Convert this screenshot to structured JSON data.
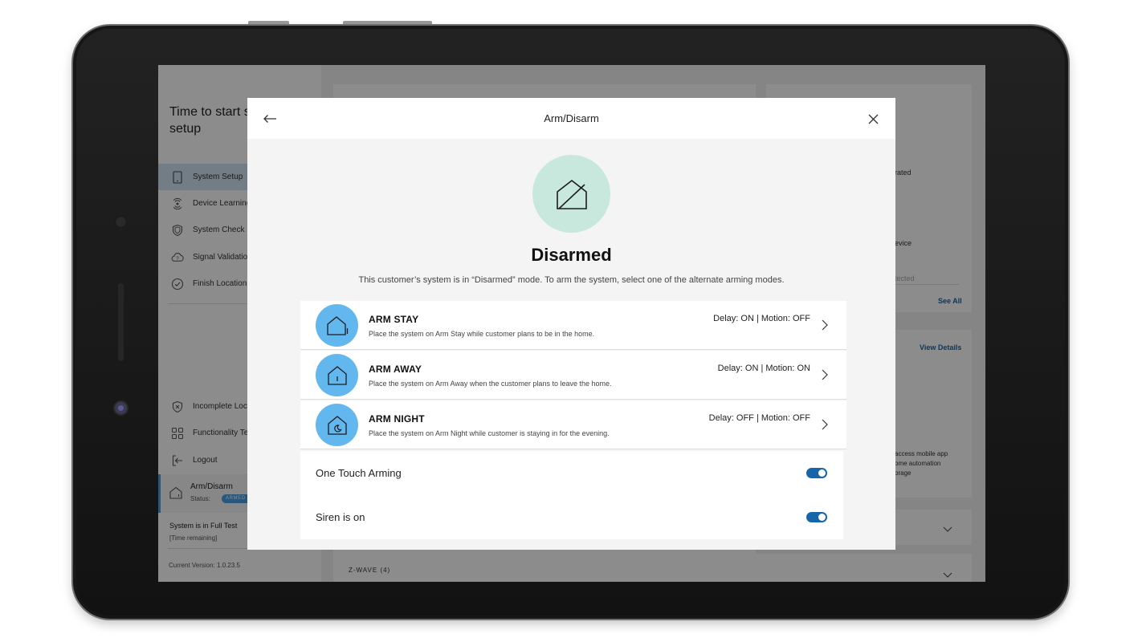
{
  "sidebar": {
    "title": "Time to start system setup",
    "items": [
      {
        "label": "System Setup",
        "icon": "tablet-icon",
        "active": true
      },
      {
        "label": "Device Learning",
        "icon": "signal-icon"
      },
      {
        "label": "System Check",
        "icon": "shield-icon"
      },
      {
        "label": "Signal Validation",
        "icon": "cloud-question-icon"
      },
      {
        "label": "Finish Location",
        "icon": "check-circle-icon"
      }
    ],
    "bottom_items": [
      {
        "label": "Incomplete Location",
        "icon": "shield-x-icon"
      },
      {
        "label": "Functionality Test",
        "icon": "grid-icon"
      },
      {
        "label": "Logout",
        "icon": "logout-icon"
      }
    ],
    "arm_card": {
      "label": "Arm/Disarm",
      "status_label": "Status:",
      "badge": "ARMED AWAY"
    },
    "test_status": "System is in Full Test",
    "time_remaining": "[Time remaining]",
    "version": "Current Version: 1.0.23.5"
  },
  "background": {
    "rated_text": "rated",
    "device_text": "evice",
    "detected_text": "tected",
    "see_all": "See All",
    "view_details": "View Details",
    "app_lines": [
      "access mobile app",
      "ome automation",
      "orage"
    ],
    "zwave": "Z-WAVE (4)"
  },
  "modal": {
    "title": "Arm/Disarm",
    "status": "Disarmed",
    "description": "This customer’s system is in “Disarmed” mode. To arm the system, select one of the alternate arming modes.",
    "modes": [
      {
        "name": "ARM STAY",
        "description": "Place the system on Arm Stay while customer plans to be in the home.",
        "status": "Delay: ON | Motion: OFF"
      },
      {
        "name": "ARM AWAY",
        "description": "Place the system on Arm Away when the customer plans to leave the home.",
        "status": "Delay: ON | Motion: ON"
      },
      {
        "name": "ARM NIGHT",
        "description": "Place the system on Arm Night while customer is staying in for the evening.",
        "status": "Delay: OFF | Motion: OFF"
      }
    ],
    "toggles": [
      {
        "label": "One Touch Arming",
        "on": true
      },
      {
        "label": "Siren is on",
        "on": true
      }
    ]
  },
  "colors": {
    "accent": "#1565a8",
    "mode_circle": "#63b7ef",
    "hero_circle": "#c8e8dd",
    "active_item": "#cfe4f3"
  }
}
